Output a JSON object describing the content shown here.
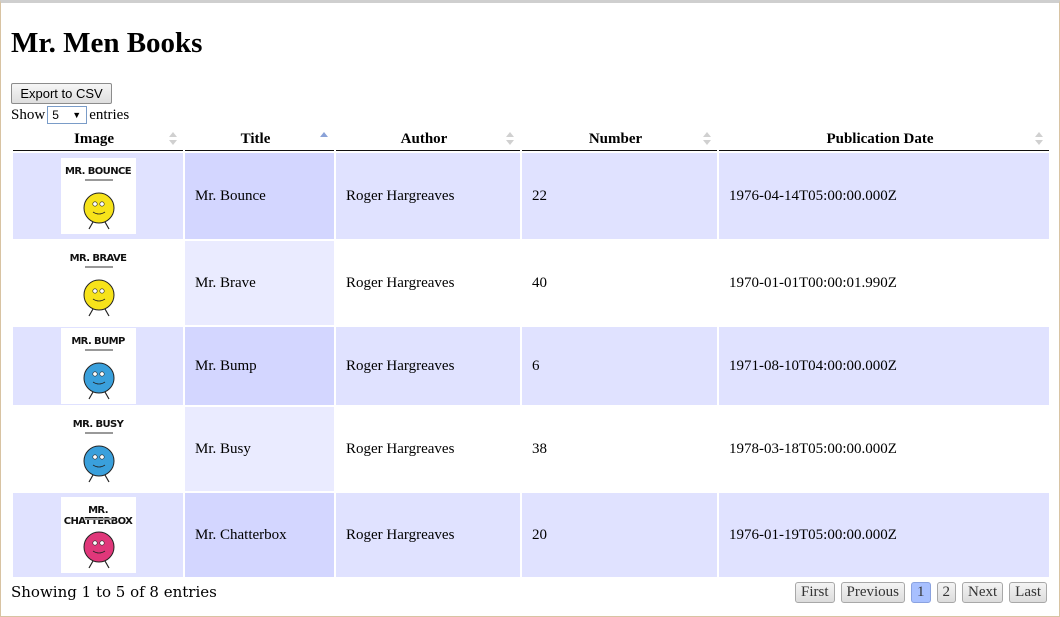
{
  "page": {
    "title": "Mr. Men Books",
    "export_label": "Export to CSV",
    "show_label": "Show",
    "entries_label": "entries",
    "page_length_value": "5"
  },
  "table": {
    "columns": [
      "Image",
      "Title",
      "Author",
      "Number",
      "Publication Date"
    ],
    "sorted_column": "Title",
    "rows": [
      {
        "cover_label": "MR. BOUNCE",
        "cover_color": "#f7e31a",
        "title": "Mr. Bounce",
        "author": "Roger Hargreaves",
        "number": "22",
        "date": "1976-04-14T05:00:00.000Z"
      },
      {
        "cover_label": "MR. BRAVE",
        "cover_color": "#f7e31a",
        "title": "Mr. Brave",
        "author": "Roger Hargreaves",
        "number": "40",
        "date": "1970-01-01T00:00:01.990Z"
      },
      {
        "cover_label": "MR. BUMP",
        "cover_color": "#3aa0dc",
        "title": "Mr. Bump",
        "author": "Roger Hargreaves",
        "number": "6",
        "date": "1971-08-10T04:00:00.000Z"
      },
      {
        "cover_label": "MR. BUSY",
        "cover_color": "#3aa0dc",
        "title": "Mr. Busy",
        "author": "Roger Hargreaves",
        "number": "38",
        "date": "1978-03-18T05:00:00.000Z"
      },
      {
        "cover_label": "MR. CHATTERBOX",
        "cover_color": "#e0377a",
        "title": "Mr. Chatterbox",
        "author": "Roger Hargreaves",
        "number": "20",
        "date": "1976-01-19T05:00:00.000Z"
      }
    ]
  },
  "footer": {
    "info": "Showing 1 to 5 of 8 entries",
    "first": "First",
    "previous": "Previous",
    "pages": [
      "1",
      "2"
    ],
    "current_page": "1",
    "next": "Next",
    "last": "Last"
  }
}
